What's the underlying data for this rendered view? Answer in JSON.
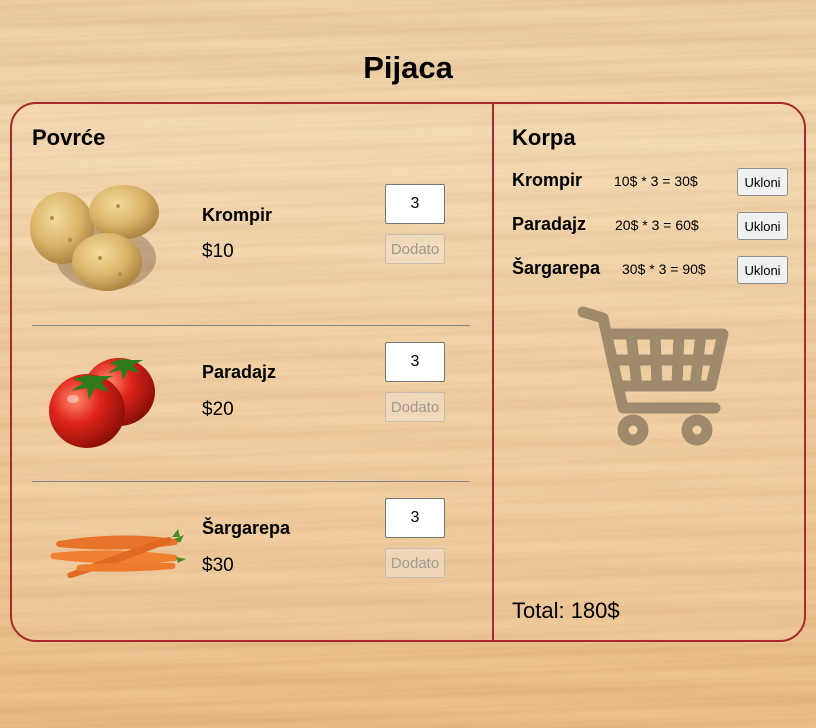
{
  "title": "Pijaca",
  "products_panel": {
    "title": "Povrće",
    "products": [
      {
        "name": "Krompir",
        "price": "$10",
        "quantity": "3",
        "button_label": "Dodato",
        "image_icon": "potato-image"
      },
      {
        "name": "Paradajz",
        "price": "$20",
        "quantity": "3",
        "button_label": "Dodato",
        "image_icon": "tomato-image"
      },
      {
        "name": "Šargarepa",
        "price": "$30",
        "quantity": "3",
        "button_label": "Dodato",
        "image_icon": "carrot-image"
      }
    ]
  },
  "cart_panel": {
    "title": "Korpa",
    "items": [
      {
        "name": "Krompir",
        "calc": "10$ * 3 = 30$",
        "button_label": "Ukloni"
      },
      {
        "name": "Paradajz",
        "calc": "20$ * 3 = 60$",
        "button_label": "Ukloni"
      },
      {
        "name": "Šargarepa",
        "calc": "30$ * 3 = 90$",
        "button_label": "Ukloni"
      }
    ],
    "cart_icon": "shopping-cart-icon",
    "total": "Total: 180$"
  },
  "colors": {
    "border": "#a52a2a",
    "cart_icon": "#a08a6e"
  }
}
